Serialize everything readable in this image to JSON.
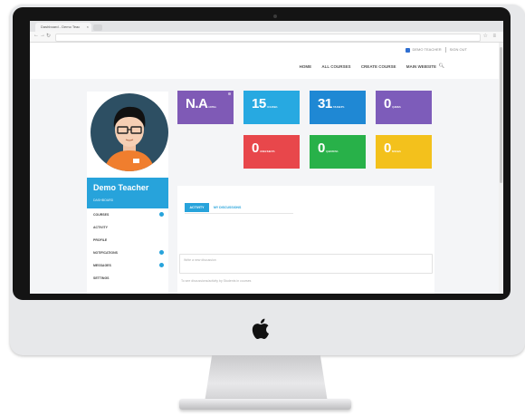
{
  "browser": {
    "tab_title": "Dashboard - Demo Teac",
    "tab_close": "×"
  },
  "header": {
    "topbar": {
      "user_label": "DEMO TEACHER",
      "signout_label": "SIGN OUT"
    },
    "nav": [
      "HOME",
      "ALL COURSES",
      "CREATE COURSE",
      "MAIN WEBSITE"
    ]
  },
  "profile": {
    "name": "Demo Teacher",
    "role": "DASHBOARD",
    "menu": [
      {
        "label": "COURSES",
        "badge": true
      },
      {
        "label": "ACTIVITY",
        "badge": false
      },
      {
        "label": "PROFILE",
        "badge": false
      },
      {
        "label": "NOTIFICATIONS",
        "badge": true
      },
      {
        "label": "MESSAGES",
        "badge": true
      },
      {
        "label": "SETTINGS",
        "badge": false
      }
    ]
  },
  "stats": [
    {
      "value": "N.A",
      "label": "RATING",
      "color": "#7f5ab6"
    },
    {
      "value": "15",
      "label": "COURSES",
      "color": "#27a9e1"
    },
    {
      "value": "31",
      "label": "STUDENTS",
      "color": "#1f88d4"
    },
    {
      "value": "0",
      "label": "QUIZZES",
      "color": "#7d5cba"
    },
    {
      "value": "0",
      "label": "ASSIGNMENTS",
      "color": "#e8474b"
    },
    {
      "value": "0",
      "label": "QUESTIONS",
      "color": "#28b149"
    },
    {
      "value": "0",
      "label": "BADGES",
      "color": "#f3c11c"
    }
  ],
  "panel": {
    "tab_active": "ACTIVITY",
    "tab_inactive": "MY DISCUSSIONS",
    "post_placeholder": "Write a new discussion",
    "note": "To see discussions/activity by Students in courses"
  },
  "colors": {
    "accent": "#27a3db",
    "bezel": "#141414",
    "aluminum": "#e7e8ea"
  }
}
